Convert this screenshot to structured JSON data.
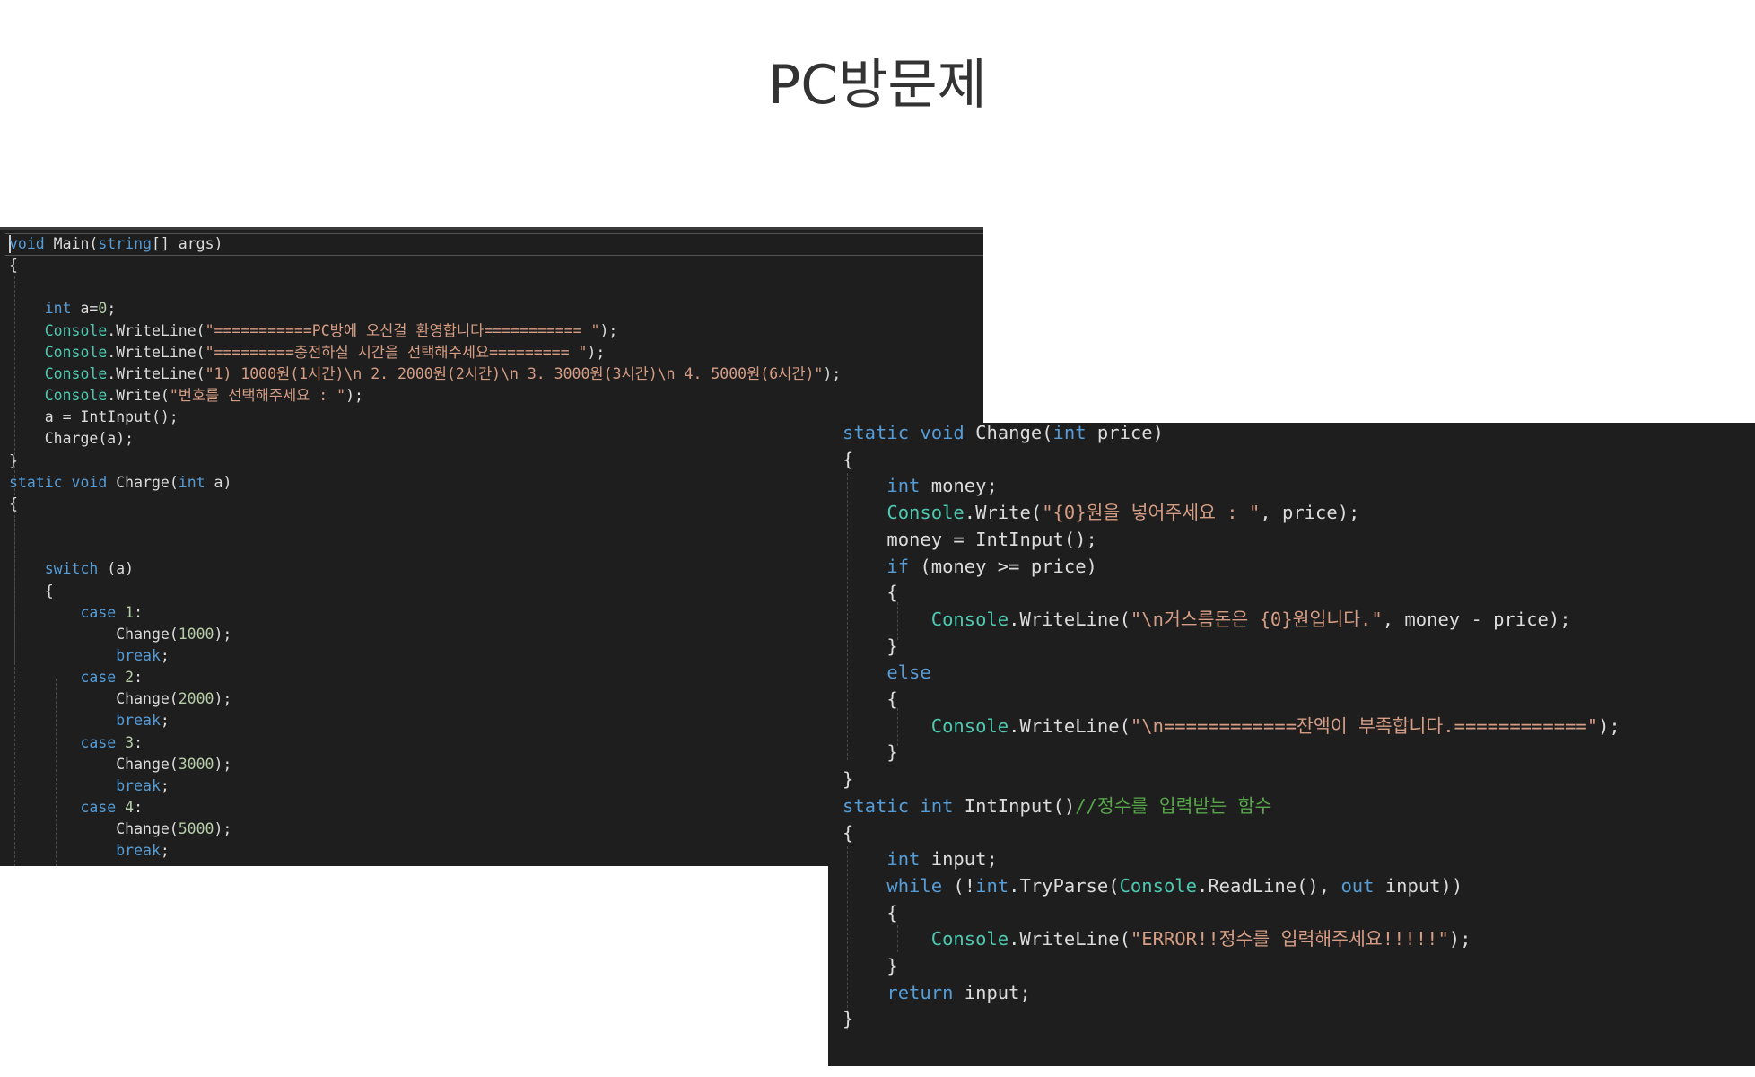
{
  "page": {
    "title": "PC방문제"
  },
  "left_code": [
    [
      [
        "kw",
        "void"
      ],
      [
        "pl",
        " Main("
      ],
      [
        "kw",
        "string"
      ],
      [
        "pl",
        "[] args)"
      ]
    ],
    [
      [
        "pl",
        "{"
      ]
    ],
    [
      [
        "pl",
        ""
      ]
    ],
    [
      [
        "pl",
        "    "
      ],
      [
        "kw",
        "int"
      ],
      [
        "pl",
        " a="
      ],
      [
        "nu",
        "0"
      ],
      [
        "pl",
        ";"
      ]
    ],
    [
      [
        "pl",
        "    "
      ],
      [
        "ty",
        "Console"
      ],
      [
        "pl",
        ".WriteLine("
      ],
      [
        "st",
        "\"===========PC방에 오신걸 환영합니다=========== \""
      ],
      [
        "pl",
        ");"
      ]
    ],
    [
      [
        "pl",
        "    "
      ],
      [
        "ty",
        "Console"
      ],
      [
        "pl",
        ".WriteLine("
      ],
      [
        "st",
        "\"=========충전하실 시간을 선택해주세요========= \""
      ],
      [
        "pl",
        ");"
      ]
    ],
    [
      [
        "pl",
        "    "
      ],
      [
        "ty",
        "Console"
      ],
      [
        "pl",
        ".WriteLine("
      ],
      [
        "st",
        "\"1) 1000원(1시간)\\n 2. 2000원(2시간)\\n 3. 3000원(3시간)\\n 4. 5000원(6시간)\""
      ],
      [
        "pl",
        ");"
      ]
    ],
    [
      [
        "pl",
        "    "
      ],
      [
        "ty",
        "Console"
      ],
      [
        "pl",
        ".Write("
      ],
      [
        "st",
        "\"번호를 선택해주세요 : \""
      ],
      [
        "pl",
        ");"
      ]
    ],
    [
      [
        "pl",
        "    a = IntInput();"
      ]
    ],
    [
      [
        "pl",
        "    Charge(a);"
      ]
    ],
    [
      [
        "pl",
        "}"
      ]
    ],
    [
      [
        "kw",
        "static"
      ],
      [
        "pl",
        " "
      ],
      [
        "kw",
        "void"
      ],
      [
        "pl",
        " Charge("
      ],
      [
        "kw",
        "int"
      ],
      [
        "pl",
        " a)"
      ]
    ],
    [
      [
        "pl",
        "{"
      ]
    ],
    [
      [
        "pl",
        ""
      ]
    ],
    [
      [
        "pl",
        ""
      ]
    ],
    [
      [
        "pl",
        "    "
      ],
      [
        "kw",
        "switch"
      ],
      [
        "pl",
        " (a)"
      ]
    ],
    [
      [
        "pl",
        "    {"
      ]
    ],
    [
      [
        "pl",
        "        "
      ],
      [
        "kw",
        "case"
      ],
      [
        "pl",
        " "
      ],
      [
        "nu",
        "1"
      ],
      [
        "pl",
        ":"
      ]
    ],
    [
      [
        "pl",
        "            Change("
      ],
      [
        "nu",
        "1000"
      ],
      [
        "pl",
        ");"
      ]
    ],
    [
      [
        "pl",
        "            "
      ],
      [
        "kw",
        "break"
      ],
      [
        "pl",
        ";"
      ]
    ],
    [
      [
        "pl",
        "        "
      ],
      [
        "kw",
        "case"
      ],
      [
        "pl",
        " "
      ],
      [
        "nu",
        "2"
      ],
      [
        "pl",
        ":"
      ]
    ],
    [
      [
        "pl",
        "            Change("
      ],
      [
        "nu",
        "2000"
      ],
      [
        "pl",
        ");"
      ]
    ],
    [
      [
        "pl",
        "            "
      ],
      [
        "kw",
        "break"
      ],
      [
        "pl",
        ";"
      ]
    ],
    [
      [
        "pl",
        "        "
      ],
      [
        "kw",
        "case"
      ],
      [
        "pl",
        " "
      ],
      [
        "nu",
        "3"
      ],
      [
        "pl",
        ":"
      ]
    ],
    [
      [
        "pl",
        "            Change("
      ],
      [
        "nu",
        "3000"
      ],
      [
        "pl",
        ");"
      ]
    ],
    [
      [
        "pl",
        "            "
      ],
      [
        "kw",
        "break"
      ],
      [
        "pl",
        ";"
      ]
    ],
    [
      [
        "pl",
        "        "
      ],
      [
        "kw",
        "case"
      ],
      [
        "pl",
        " "
      ],
      [
        "nu",
        "4"
      ],
      [
        "pl",
        ":"
      ]
    ],
    [
      [
        "pl",
        "            Change("
      ],
      [
        "nu",
        "5000"
      ],
      [
        "pl",
        ");"
      ]
    ],
    [
      [
        "pl",
        "            "
      ],
      [
        "kw",
        "break"
      ],
      [
        "pl",
        ";"
      ]
    ],
    [
      [
        "pl",
        "    }"
      ]
    ],
    [
      [
        "pl",
        "}"
      ]
    ]
  ],
  "right_code": [
    [
      [
        "kw",
        "static"
      ],
      [
        "pl",
        " "
      ],
      [
        "kw",
        "void"
      ],
      [
        "pl",
        " Change("
      ],
      [
        "kw",
        "int"
      ],
      [
        "pl",
        " price)"
      ]
    ],
    [
      [
        "pl",
        "{"
      ]
    ],
    [
      [
        "pl",
        "    "
      ],
      [
        "kw",
        "int"
      ],
      [
        "pl",
        " money;"
      ]
    ],
    [
      [
        "pl",
        "    "
      ],
      [
        "ty",
        "Console"
      ],
      [
        "pl",
        ".Write("
      ],
      [
        "st",
        "\"{0}원을 넣어주세요 : \""
      ],
      [
        "pl",
        ", price);"
      ]
    ],
    [
      [
        "pl",
        "    money = IntInput();"
      ]
    ],
    [
      [
        "pl",
        "    "
      ],
      [
        "kw",
        "if"
      ],
      [
        "pl",
        " (money >= price)"
      ]
    ],
    [
      [
        "pl",
        "    {"
      ]
    ],
    [
      [
        "pl",
        "        "
      ],
      [
        "ty",
        "Console"
      ],
      [
        "pl",
        ".WriteLine("
      ],
      [
        "st",
        "\"\\n거스름돈은 {0}원입니다.\""
      ],
      [
        "pl",
        ", money - price);"
      ]
    ],
    [
      [
        "pl",
        "    }"
      ]
    ],
    [
      [
        "pl",
        "    "
      ],
      [
        "kw",
        "else"
      ]
    ],
    [
      [
        "pl",
        "    {"
      ]
    ],
    [
      [
        "pl",
        "        "
      ],
      [
        "ty",
        "Console"
      ],
      [
        "pl",
        ".WriteLine("
      ],
      [
        "st",
        "\"\\n============잔액이 부족합니다.============\""
      ],
      [
        "pl",
        ");"
      ]
    ],
    [
      [
        "pl",
        "    }"
      ]
    ],
    [
      [
        "pl",
        "}"
      ]
    ],
    [
      [
        "kw",
        "static"
      ],
      [
        "pl",
        " "
      ],
      [
        "kw",
        "int"
      ],
      [
        "pl",
        " IntInput()"
      ],
      [
        "cm",
        "//정수를 입력받는 함수"
      ]
    ],
    [
      [
        "pl",
        "{"
      ]
    ],
    [
      [
        "pl",
        "    "
      ],
      [
        "kw",
        "int"
      ],
      [
        "pl",
        " input;"
      ]
    ],
    [
      [
        "pl",
        "    "
      ],
      [
        "kw",
        "while"
      ],
      [
        "pl",
        " (!"
      ],
      [
        "kw",
        "int"
      ],
      [
        "pl",
        ".TryParse("
      ],
      [
        "ty",
        "Console"
      ],
      [
        "pl",
        ".ReadLine(), "
      ],
      [
        "kw",
        "out"
      ],
      [
        "pl",
        " input))"
      ]
    ],
    [
      [
        "pl",
        "    {"
      ]
    ],
    [
      [
        "pl",
        "        "
      ],
      [
        "ty",
        "Console"
      ],
      [
        "pl",
        ".WriteLine("
      ],
      [
        "st",
        "\"ERROR!!정수를 입력해주세요!!!!!\""
      ],
      [
        "pl",
        ");"
      ]
    ],
    [
      [
        "pl",
        "    }"
      ]
    ],
    [
      [
        "pl",
        "    "
      ],
      [
        "kw",
        "return"
      ],
      [
        "pl",
        " input;"
      ]
    ],
    [
      [
        "pl",
        "}"
      ]
    ]
  ],
  "colors": {
    "editor_background": "#1e1e1e",
    "keyword": "#569cd6",
    "type": "#4ec9b0",
    "string": "#d69d85",
    "number": "#b5cea8",
    "comment": "#57a64a",
    "plain": "#dcdcdc"
  }
}
